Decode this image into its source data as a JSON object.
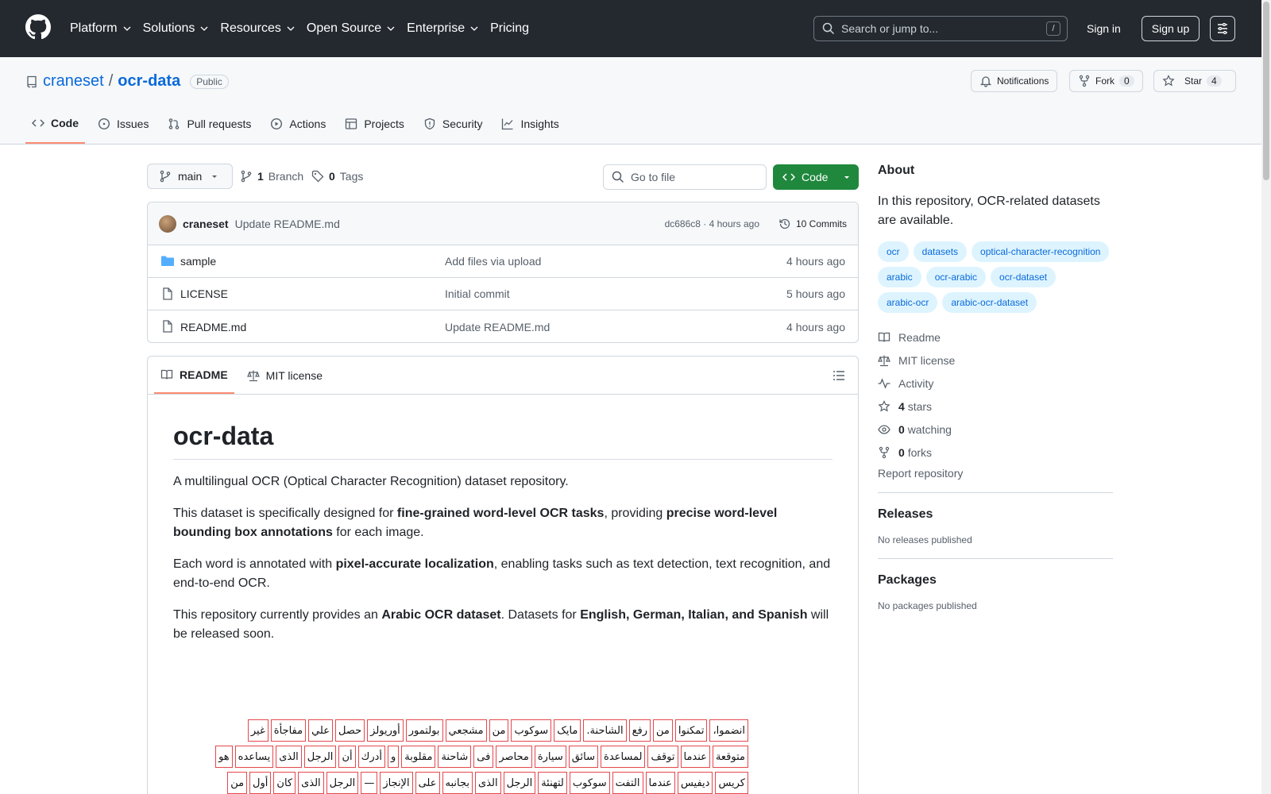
{
  "header": {
    "nav": [
      {
        "label": "Platform",
        "has_menu": true
      },
      {
        "label": "Solutions",
        "has_menu": true
      },
      {
        "label": "Resources",
        "has_menu": true
      },
      {
        "label": "Open Source",
        "has_menu": true
      },
      {
        "label": "Enterprise",
        "has_menu": true
      },
      {
        "label": "Pricing",
        "has_menu": false
      }
    ],
    "search_placeholder": "Search or jump to...",
    "search_shortcut": "/",
    "signin": "Sign in",
    "signup": "Sign up"
  },
  "repo": {
    "owner": "craneset",
    "separator": "/",
    "name": "ocr-data",
    "visibility": "Public",
    "notifications": "Notifications",
    "fork_label": "Fork",
    "fork_count": "0",
    "star_label": "Star",
    "star_count": "4",
    "tabs": [
      "Code",
      "Issues",
      "Pull requests",
      "Actions",
      "Projects",
      "Security",
      "Insights"
    ]
  },
  "toolbar": {
    "branch": "main",
    "branch_count": "1",
    "branch_label": "Branch",
    "tag_count": "0",
    "tag_label": "Tags",
    "goto_placeholder": "Go to file",
    "code_button": "Code"
  },
  "latest_commit": {
    "author": "craneset",
    "message": "Update README.md",
    "hash_time": "dc686c8 · 4 hours ago",
    "commits": "10 Commits"
  },
  "files": [
    {
      "type": "folder",
      "name": "sample",
      "message": "Add files via upload",
      "date": "4 hours ago"
    },
    {
      "type": "file",
      "name": "LICENSE",
      "message": "Initial commit",
      "date": "5 hours ago"
    },
    {
      "type": "file",
      "name": "README.md",
      "message": "Update README.md",
      "date": "4 hours ago"
    }
  ],
  "readme": {
    "tab_readme": "README",
    "tab_license": "MIT license",
    "title": "ocr-data",
    "p1": "A multilingual OCR (Optical Character Recognition) dataset repository.",
    "p2": {
      "a": "This dataset is specifically designed for ",
      "b": "fine-grained word-level OCR tasks",
      "c": ", providing ",
      "d": "precise word-level bounding box annotations",
      "e": " for each image."
    },
    "p3": {
      "a": "Each word is annotated with ",
      "b": "pixel-accurate localization",
      "c": ", enabling tasks such as text detection, text recognition, and end-to-end OCR."
    },
    "p4": {
      "a": "This repository currently provides an ",
      "b": "Arabic OCR dataset",
      "c": ". Datasets for ",
      "d": "English, German, Italian, and Spanish",
      "e": " will be released soon."
    },
    "sample_rows": [
      [
        "انضموا،",
        "تمكنوا",
        "من",
        "رفع",
        "الشاحنة.",
        "مايک",
        "سوكوب",
        "من",
        "مشجعي",
        "بولتمور",
        "أوريولز",
        "حصل",
        "علي",
        "مفاجأة",
        "غير"
      ],
      [
        "متوقعة",
        "عندما",
        "توقف",
        "لمساعدة",
        "سائق",
        "سيارة",
        "محاصر",
        "فی",
        "شاحنة",
        "مقلوبة",
        "و",
        "أدرك",
        "أن",
        "الرجل",
        "الذی",
        "يساعده",
        "هو"
      ],
      [
        "كريس",
        "ديفيس",
        "عندما",
        "التفت",
        "سوكوب",
        "لتهنئة",
        "الرجل",
        "الذی",
        "بجانبه",
        "على",
        "الإنجاز",
        "—",
        "الرجل",
        "الذی",
        "كان",
        "أول",
        "من"
      ]
    ]
  },
  "about": {
    "heading": "About",
    "description": "In this repository, OCR-related datasets are available.",
    "topics": [
      "ocr",
      "datasets",
      "optical-character-recognition",
      "arabic",
      "ocr-arabic",
      "ocr-dataset",
      "arabic-ocr",
      "arabic-ocr-dataset"
    ],
    "readme": "Readme",
    "license": "MIT license",
    "activity": "Activity",
    "stars_count": "4",
    "stars_label": "stars",
    "watching_count": "0",
    "watching_label": "watching",
    "forks_count": "0",
    "forks_label": "forks",
    "report": "Report repository"
  },
  "releases": {
    "heading": "Releases",
    "note": "No releases published"
  },
  "packages": {
    "heading": "Packages",
    "note": "No packages published"
  },
  "colors": {
    "header_bg": "#24292f",
    "link": "#0969da",
    "code_green": "#1f883d",
    "active_tab": "#fd8c73",
    "topic_bg": "#ddf4ff",
    "box_border": "#e5484d"
  }
}
